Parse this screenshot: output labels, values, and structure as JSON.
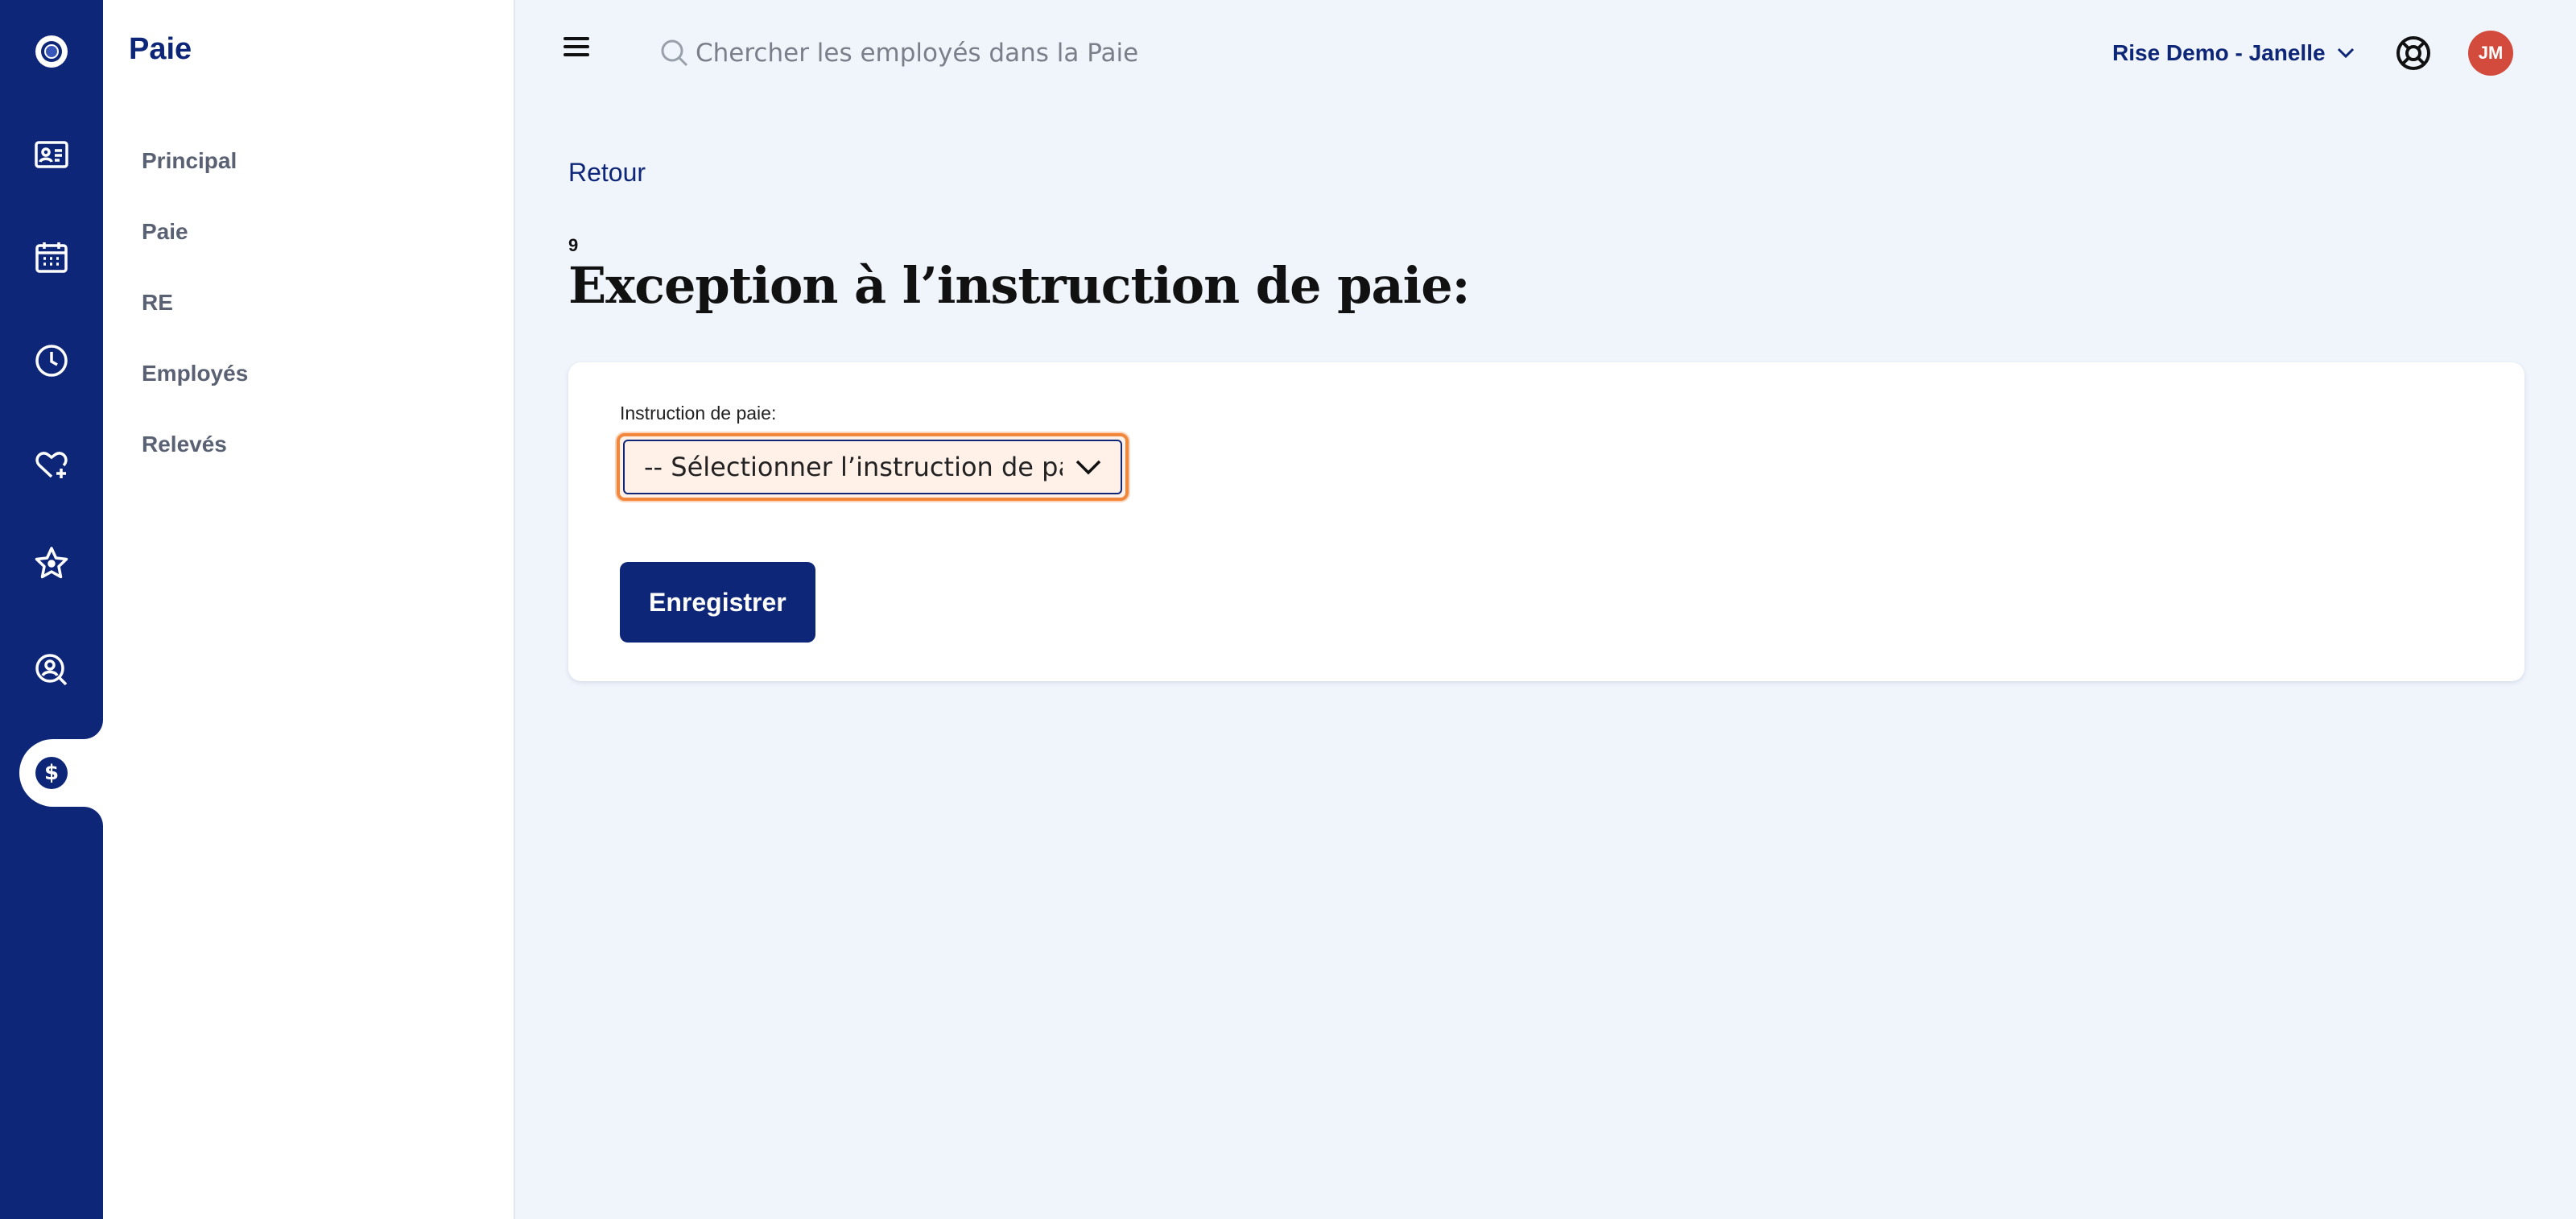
{
  "sidebar": {
    "title": "Paie",
    "items": [
      {
        "label": "Principal"
      },
      {
        "label": "Paie"
      },
      {
        "label": "RE"
      },
      {
        "label": "Employés"
      },
      {
        "label": "Relevés"
      }
    ]
  },
  "topbar": {
    "search_placeholder": "Chercher les employés dans la Paie",
    "org_label": "Rise Demo - Janelle",
    "avatar_initials": "JM"
  },
  "main": {
    "back_label": "Retour",
    "step_number": "9",
    "title": "Exception à l’instruction de paie:",
    "form": {
      "field_label": "Instruction de paie:",
      "select_value": "-- Sélectionner l’instruction de paie --",
      "save_label": "Enregistrer"
    }
  },
  "colors": {
    "brand_navy": "#0e2677",
    "background": "#f0f4fb",
    "focus_orange": "#f0873d",
    "avatar_red": "#d24b3d"
  },
  "icons": {
    "rail": [
      "logo-icon",
      "id-card-icon",
      "calendar-icon",
      "clock-icon",
      "heart-plus-icon",
      "star-icon",
      "search-person-icon",
      "dollar-icon"
    ]
  }
}
